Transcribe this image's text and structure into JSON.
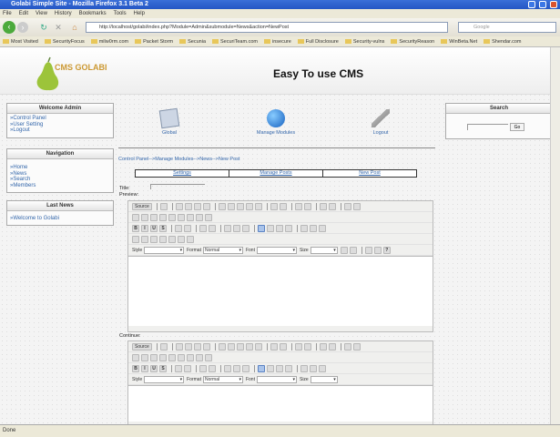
{
  "browser": {
    "title": "Golabi Simple Site - Mozilla Firefox 3.1 Beta 2",
    "menu": [
      "File",
      "Edit",
      "View",
      "History",
      "Bookmarks",
      "Tools",
      "Help"
    ],
    "url": "http://localhost/golabi/index.php?Module=Admin&submodule=News&action=NewPost",
    "search_placeholder": "Google",
    "bookmarks": [
      "Most Visited",
      "SecurityFocus",
      "milw0rm.com",
      "Packet Storm",
      "Secunia",
      "SecuriTeam.com",
      "insecure",
      "Full Disclosure",
      "Security-vulns",
      "SecurityReason",
      "WinBeta.Net",
      "Shendar.com"
    ],
    "status": "Done"
  },
  "header": {
    "logo_text": "CMS GOLABI",
    "title": "Easy To use CMS"
  },
  "welcome": {
    "title": "Welcome Admin",
    "links": [
      "»Control Panel",
      "»User Setting",
      "»Logout"
    ]
  },
  "navigation": {
    "title": "Navigation",
    "links": [
      "»Home",
      "»News",
      "»Search",
      "»Members"
    ]
  },
  "last_news": {
    "title": "Last News",
    "links": [
      "»Welcome to Golabi"
    ]
  },
  "search": {
    "title": "Search",
    "button": "Go"
  },
  "modules": [
    {
      "label": "Global"
    },
    {
      "label": "Manage Modules"
    },
    {
      "label": "Logout"
    }
  ],
  "breadcrumb": "Control Panel-->Manage Modules-->News-->New Post",
  "tabs": [
    "Settings",
    "Manage Posts",
    "New Post"
  ],
  "form": {
    "title_label": "Title:",
    "preview_label": "Preview:",
    "continue_label": "Continue:"
  },
  "editor": {
    "source_label": "Source",
    "style_label": "Style",
    "format_label": "Format",
    "format_value": "Normal",
    "font_label": "Font",
    "size_label": "Size",
    "rows": [
      [
        "source",
        "|",
        "doc-props",
        "|",
        "save",
        "new-page",
        "preview",
        "templates",
        "|",
        "cut",
        "copy",
        "paste",
        "paste-text",
        "paste-word",
        "|",
        "print",
        "spellcheck",
        "|",
        "undo",
        "redo",
        "|",
        "find",
        "replace",
        "|",
        "select-all",
        "remove-format"
      ],
      [
        "form",
        "checkbox",
        "radio",
        "text-field",
        "textarea",
        "select",
        "button",
        "image-button",
        "hidden-field"
      ],
      [
        "B",
        "I",
        "U",
        "S",
        "|",
        "subscript",
        "superscript",
        "|",
        "ol",
        "ul",
        "|",
        "outdent",
        "indent",
        "blockquote",
        "|",
        "align-left*",
        "align-center",
        "align-right",
        "justify",
        "|",
        "link",
        "unlink",
        "anchor"
      ],
      [
        "image",
        "flash",
        "table",
        "horizontal-rule",
        "smiley",
        "special-char",
        "page-break"
      ]
    ],
    "rows2": [
      [
        "source",
        "|",
        "doc-props",
        "|",
        "save",
        "new-page",
        "preview",
        "templates",
        "|",
        "cut",
        "copy",
        "paste",
        "paste-text",
        "paste-word",
        "|",
        "print",
        "spellcheck",
        "|",
        "undo",
        "redo",
        "|",
        "find",
        "replace",
        "|",
        "select-all",
        "remove-format"
      ],
      [
        "form",
        "checkbox",
        "radio",
        "text-field",
        "textarea",
        "select",
        "button",
        "image-button",
        "hidden-field"
      ],
      [
        "B",
        "I",
        "U",
        "S",
        "|",
        "subscript",
        "superscript",
        "|",
        "ol",
        "ul",
        "|",
        "outdent",
        "indent",
        "blockquote",
        "|",
        "align-left*",
        "align-center",
        "align-right",
        "justify",
        "|",
        "link",
        "unlink",
        "anchor"
      ]
    ]
  },
  "colors": {
    "link": "#3366aa",
    "titlebar": "#2456c4"
  }
}
